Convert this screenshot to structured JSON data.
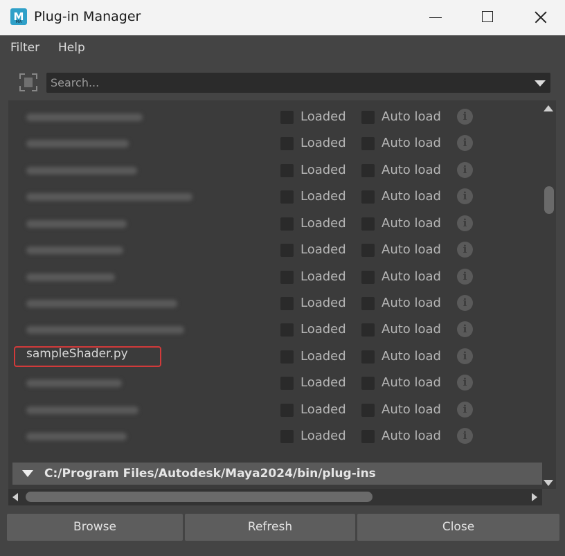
{
  "window": {
    "title": "Plug-in Manager",
    "app_icon_letter": "M",
    "app_icon_sub": "MA"
  },
  "menu": {
    "items": [
      "Filter",
      "Help"
    ]
  },
  "search": {
    "placeholder": "Search..."
  },
  "plugins": {
    "loaded_label": "Loaded",
    "auto_load_label": "Auto load",
    "info_glyph": "i",
    "highlighted_name": "sampleShader.py",
    "section_path": "C:/Program Files/Autodesk/Maya2024/bin/plug-ins"
  },
  "buttons": {
    "browse": "Browse",
    "refresh": "Refresh",
    "close": "Close"
  },
  "colors": {
    "highlight": "#d23a3a",
    "app_icon": "#2fa0c8"
  }
}
